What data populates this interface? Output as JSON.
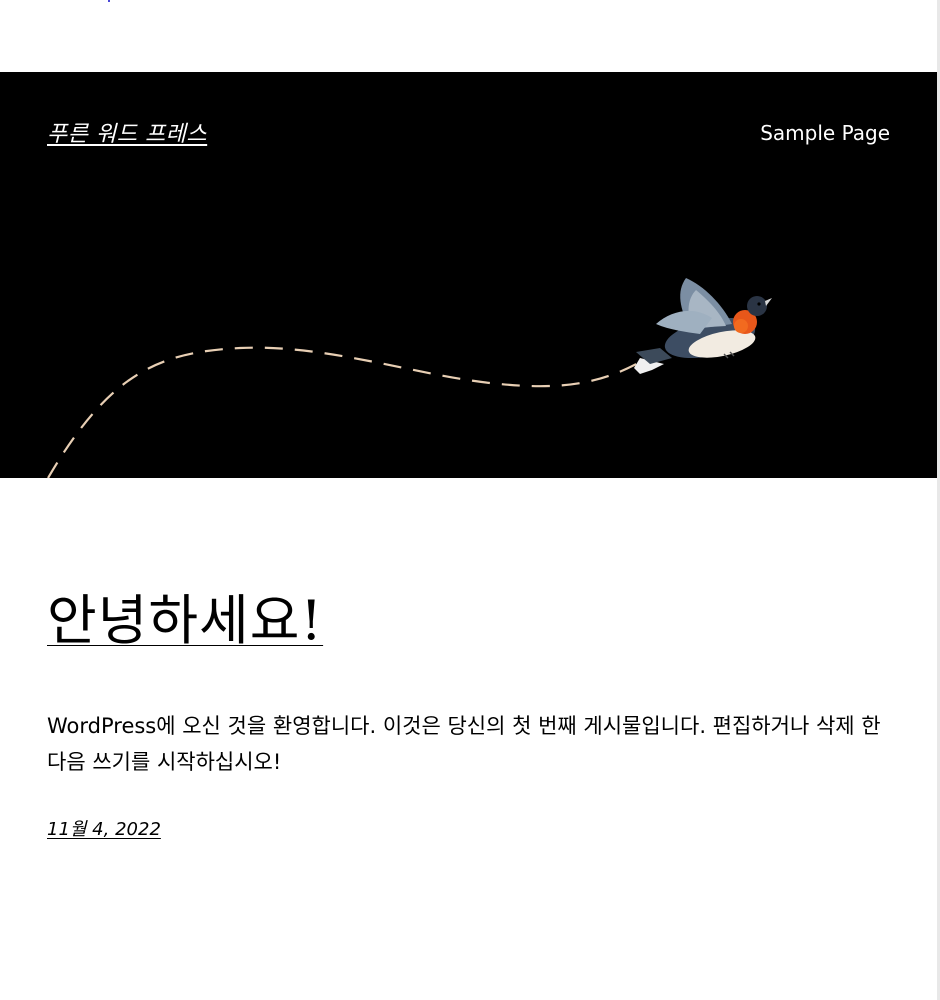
{
  "header": {
    "site_title": "푸른 워드 프레스",
    "nav": {
      "sample_page": "Sample Page"
    },
    "hero_colors": {
      "background": "#000000",
      "path": "#e8cfb4"
    }
  },
  "post": {
    "title": "안녕하세요!",
    "body": "WordPress에 오신 것을 환영합니다. 이것은 당신의 첫 번째 게시물입니다. 편집하거나 삭제 한 다음 쓰기를 시작하십시오!",
    "date": "11월 4, 2022"
  }
}
